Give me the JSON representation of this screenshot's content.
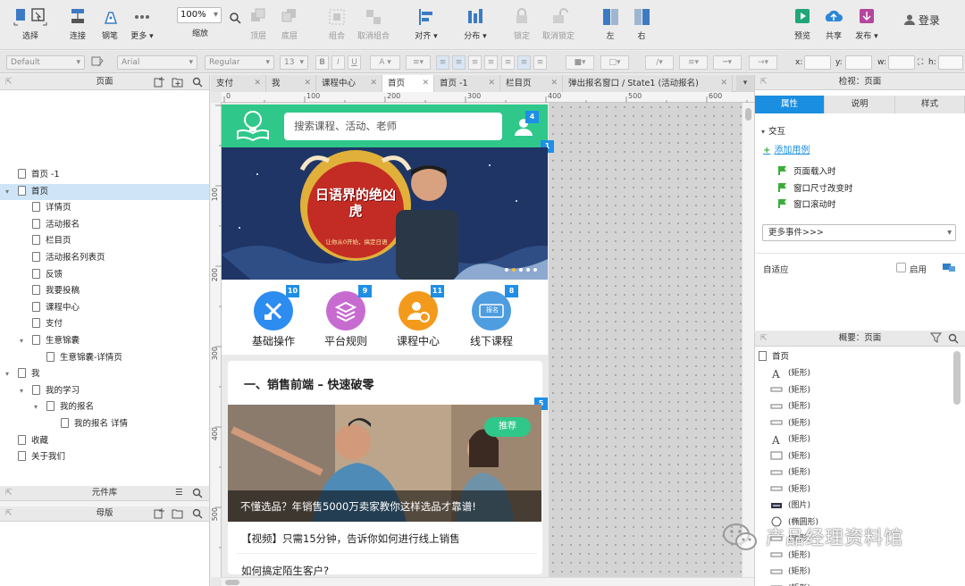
{
  "toolbar": {
    "select": "选择",
    "connect": "连接",
    "pen": "钢笔",
    "more": "更多 ▾",
    "zoom_value": "100%",
    "zoom_label": "缩放",
    "top": "顶层",
    "bottom": "底层",
    "group": "组合",
    "ungroup": "取消组合",
    "align": "对齐 ▾",
    "distribute": "分布 ▾",
    "lock": "锁定",
    "unlock": "取消锁定",
    "left": "左",
    "right": "右",
    "preview": "预览",
    "share": "共享",
    "publish": "发布 ▾",
    "login": "登录"
  },
  "formatbar": {
    "style": "Default",
    "font": "Arial",
    "weight": "Regular",
    "size": "13",
    "bold": "B",
    "italic": "I",
    "underline": "U",
    "x_label": "x:",
    "y_label": "y:",
    "w_label": "w:",
    "h_label": "h:"
  },
  "pages_panel": {
    "title": "页面",
    "items": [
      {
        "label": "首页 -1",
        "level": 0,
        "expander": ""
      },
      {
        "label": "首页",
        "level": 0,
        "expander": "▾",
        "selected": true
      },
      {
        "label": "详情页",
        "level": 1,
        "expander": ""
      },
      {
        "label": "活动报名",
        "level": 1,
        "expander": ""
      },
      {
        "label": "栏目页",
        "level": 1,
        "expander": ""
      },
      {
        "label": "活动报名列表页",
        "level": 1,
        "expander": ""
      },
      {
        "label": "反馈",
        "level": 1,
        "expander": ""
      },
      {
        "label": "我要投稿",
        "level": 1,
        "expander": ""
      },
      {
        "label": "课程中心",
        "level": 1,
        "expander": ""
      },
      {
        "label": "支付",
        "level": 1,
        "expander": ""
      },
      {
        "label": "生意锦囊",
        "level": 1,
        "expander": "▾"
      },
      {
        "label": "生意锦囊-详情页",
        "level": 2,
        "expander": ""
      },
      {
        "label": "我",
        "level": 0,
        "expander": "▾"
      },
      {
        "label": "我的学习",
        "level": 1,
        "expander": "▾"
      },
      {
        "label": "我的报名",
        "level": 2,
        "expander": "▾"
      },
      {
        "label": "我的报名 详情",
        "level": 3,
        "expander": ""
      },
      {
        "label": "收藏",
        "level": 0,
        "expander": ""
      },
      {
        "label": "关于我们",
        "level": 0,
        "expander": ""
      }
    ]
  },
  "library_panel": {
    "title": "元件库"
  },
  "masters_panel": {
    "title": "母版"
  },
  "tabs": [
    {
      "label": "支付",
      "active": false
    },
    {
      "label": "我",
      "active": false
    },
    {
      "label": "课程中心",
      "active": false
    },
    {
      "label": "首页",
      "active": true
    },
    {
      "label": "首页 -1",
      "active": false
    },
    {
      "label": "栏目页",
      "active": false
    },
    {
      "label": "弹出报名窗口 / State1 (活动报名)",
      "active": false
    }
  ],
  "ruler": {
    "h_ticks": [
      "0",
      "100",
      "200",
      "300",
      "400",
      "500",
      "600"
    ],
    "v_ticks": [
      "100",
      "200",
      "300",
      "400",
      "500"
    ]
  },
  "mobile": {
    "search_placeholder": "搜索课程、活动、老师",
    "banner_title": "日语界的绝凶虎",
    "banner_sub": "让你从0开始，搞定日语",
    "icons": [
      {
        "label": "基础操作",
        "badge": "10",
        "color": "#2d8cf0"
      },
      {
        "label": "平台规则",
        "badge": "9",
        "color": "#c86bd0"
      },
      {
        "label": "课程中心",
        "badge": "11",
        "color": "#f39a1c"
      },
      {
        "label": "线下课程",
        "badge": "8",
        "color": "#4d9de0"
      }
    ],
    "icon4_tag": "报名",
    "badge_header": "1",
    "badge_user": "4",
    "badge_section": "5",
    "section_title": "一、销售前端 – 快速破零",
    "recommend": "推荐",
    "card_caption": "不懂选品？年销售5000万卖家教你这样选品才靠谱!",
    "item1": "【视频】只需15分钟，告诉你如何进行线上销售",
    "item2": "如何搞定陌生客户?"
  },
  "inspector": {
    "title": "检视：页面",
    "tabs": [
      "属性",
      "说明",
      "样式"
    ],
    "interaction": "交互",
    "add_case": "添加用例",
    "events": [
      "页面载入时",
      "窗口尺寸改变时",
      "窗口滚动时"
    ],
    "more_events": "更多事件>>>",
    "adaptive": "自适应",
    "enable": "启用"
  },
  "outline": {
    "title": "概要：页面",
    "root": "首页",
    "items": [
      {
        "label": "(矩形)",
        "icon": "text"
      },
      {
        "label": "(矩形)",
        "icon": "line"
      },
      {
        "label": "(矩形)",
        "icon": "line"
      },
      {
        "label": "(矩形)",
        "icon": "line"
      },
      {
        "label": "(矩形)",
        "icon": "text"
      },
      {
        "label": "(矩形)",
        "icon": "rect"
      },
      {
        "label": "(矩形)",
        "icon": "line"
      },
      {
        "label": "(矩形)",
        "icon": "line"
      },
      {
        "label": "(图片)",
        "icon": "image"
      },
      {
        "label": "(椭圆形)",
        "icon": "ellipse"
      },
      {
        "label": "(矩形)",
        "icon": "line"
      },
      {
        "label": "(矩形)",
        "icon": "line"
      },
      {
        "label": "(矩形)",
        "icon": "line"
      },
      {
        "label": "(矩形)",
        "icon": "line"
      }
    ]
  },
  "watermark": "产品经理资料馆"
}
